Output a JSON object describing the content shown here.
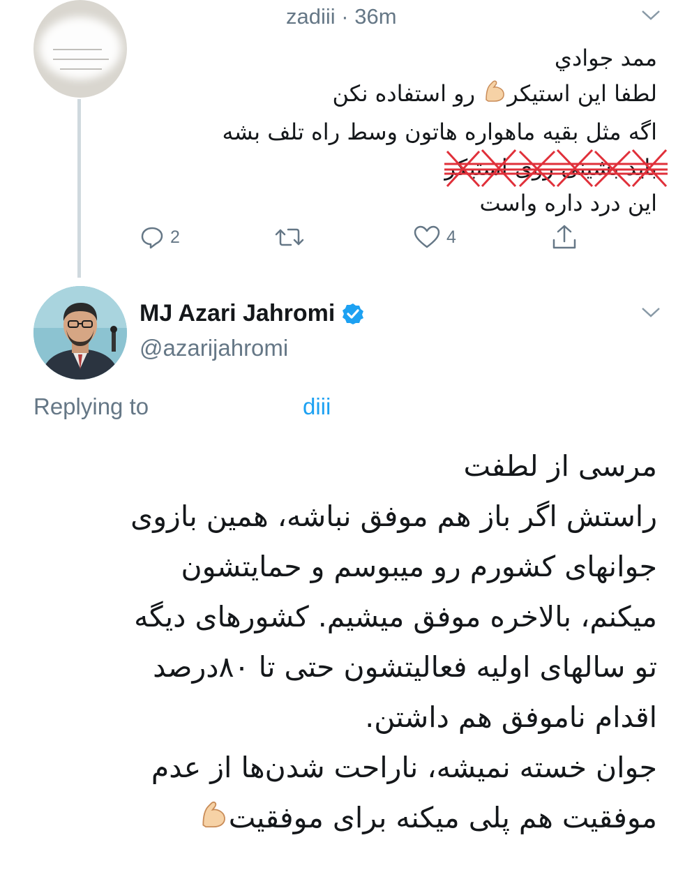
{
  "parent_tweet": {
    "user_name": "zadiii",
    "time": "36m",
    "separator": "·",
    "lines": [
      "ممد جوادي",
      "لطفا این استیکر",
      "رو استفاده نکن",
      "اگه مثل بقیه ماهواره هاتون وسط راه تلف بشه",
      "باید",
      "بشینی روی استیکر",
      "این درد داره واست"
    ],
    "reply_count": "2",
    "like_count": "4"
  },
  "main_tweet": {
    "author_name": "MJ Azari Jahromi",
    "handle": "@azarijahromi",
    "replying_label": "Replying to",
    "reply_target": "diii",
    "lines": [
      "مرسی از لطفت",
      "راستش اگر باز هم موفق نباشه، همین بازوی",
      "جوانهای کشورم رو میبوسم و حمایتشون",
      "میکنم، بالاخره موفق میشیم. کشورهای دیگه",
      "تو سالهای اولیه فعالیتشون حتی تا ۸۰درصد",
      "اقدام ناموفق هم داشتن.",
      "جوان خسته نمیشه، ناراحت شدن‌ها از عدم",
      "موفقیت هم پلی میکنه برای موفقیت"
    ]
  },
  "icons": {
    "reply": "reply-icon",
    "retweet": "retweet-icon",
    "like": "like-icon",
    "share": "share-icon",
    "verified": "verified-badge-icon",
    "muscle": "flexed-biceps-emoji",
    "caret": "chevron-down-icon"
  },
  "colors": {
    "text": "#14171a",
    "muted": "#657786",
    "accent": "#1da1f2",
    "thread_line": "#cfd9de",
    "strike": "#e0303a"
  }
}
